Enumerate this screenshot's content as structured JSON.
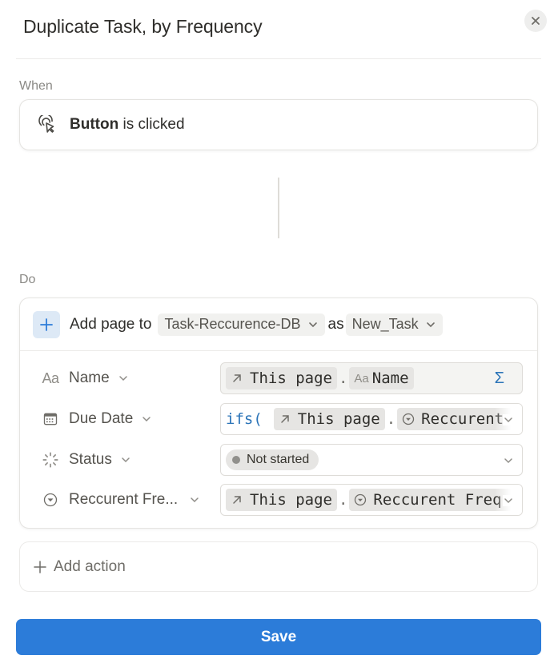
{
  "dialog": {
    "title": "Duplicate Task, by Frequency",
    "close_icon": "close-icon"
  },
  "when": {
    "section_label": "When",
    "trigger_icon": "click-pointer-icon",
    "trigger_subject": "Button",
    "trigger_predicate": "is clicked"
  },
  "do": {
    "section_label": "Do",
    "action": {
      "icon": "plus-icon",
      "prefix": "Add page to",
      "database": "Task-Reccurence-DB",
      "as_label": "as",
      "variable": "New_Task"
    },
    "properties": [
      {
        "name": "Name",
        "icon": "text-aa-icon",
        "icon_text": "Aa",
        "value_tokens": [
          {
            "kind": "ref",
            "icon": "arrow-up-right-icon",
            "text": "This page"
          },
          {
            "kind": "sep",
            "text": "."
          },
          {
            "kind": "prop",
            "icon_text": "Aa",
            "text": "Name"
          }
        ],
        "trailing_icon": "sigma-icon",
        "trailing_text": "Σ"
      },
      {
        "name": "Due Date",
        "icon": "calendar-icon",
        "keyword": "ifs(",
        "value_tokens": [
          {
            "kind": "ref",
            "icon": "arrow-up-right-icon",
            "text": "This page"
          },
          {
            "kind": "sep",
            "text": "."
          },
          {
            "kind": "prop",
            "icon": "select-circle-icon",
            "text": "Reccurent Frequency"
          }
        ]
      },
      {
        "name": "Status",
        "icon": "status-spinner-icon",
        "value": "Not started"
      },
      {
        "name": "Reccurent Fre...",
        "icon": "select-circle-icon",
        "value_tokens": [
          {
            "kind": "ref",
            "icon": "arrow-up-right-icon",
            "text": "This page"
          },
          {
            "kind": "sep",
            "text": "."
          },
          {
            "kind": "prop",
            "icon": "select-circle-icon",
            "text": "Reccurent Frequency"
          }
        ]
      }
    ]
  },
  "add_action": {
    "label": "Add action",
    "icon": "plus-icon"
  },
  "save": {
    "label": "Save"
  },
  "colors": {
    "primary": "#2c7cd9",
    "formula_blue": "#2b74b8",
    "status_gray": "#91908c"
  }
}
